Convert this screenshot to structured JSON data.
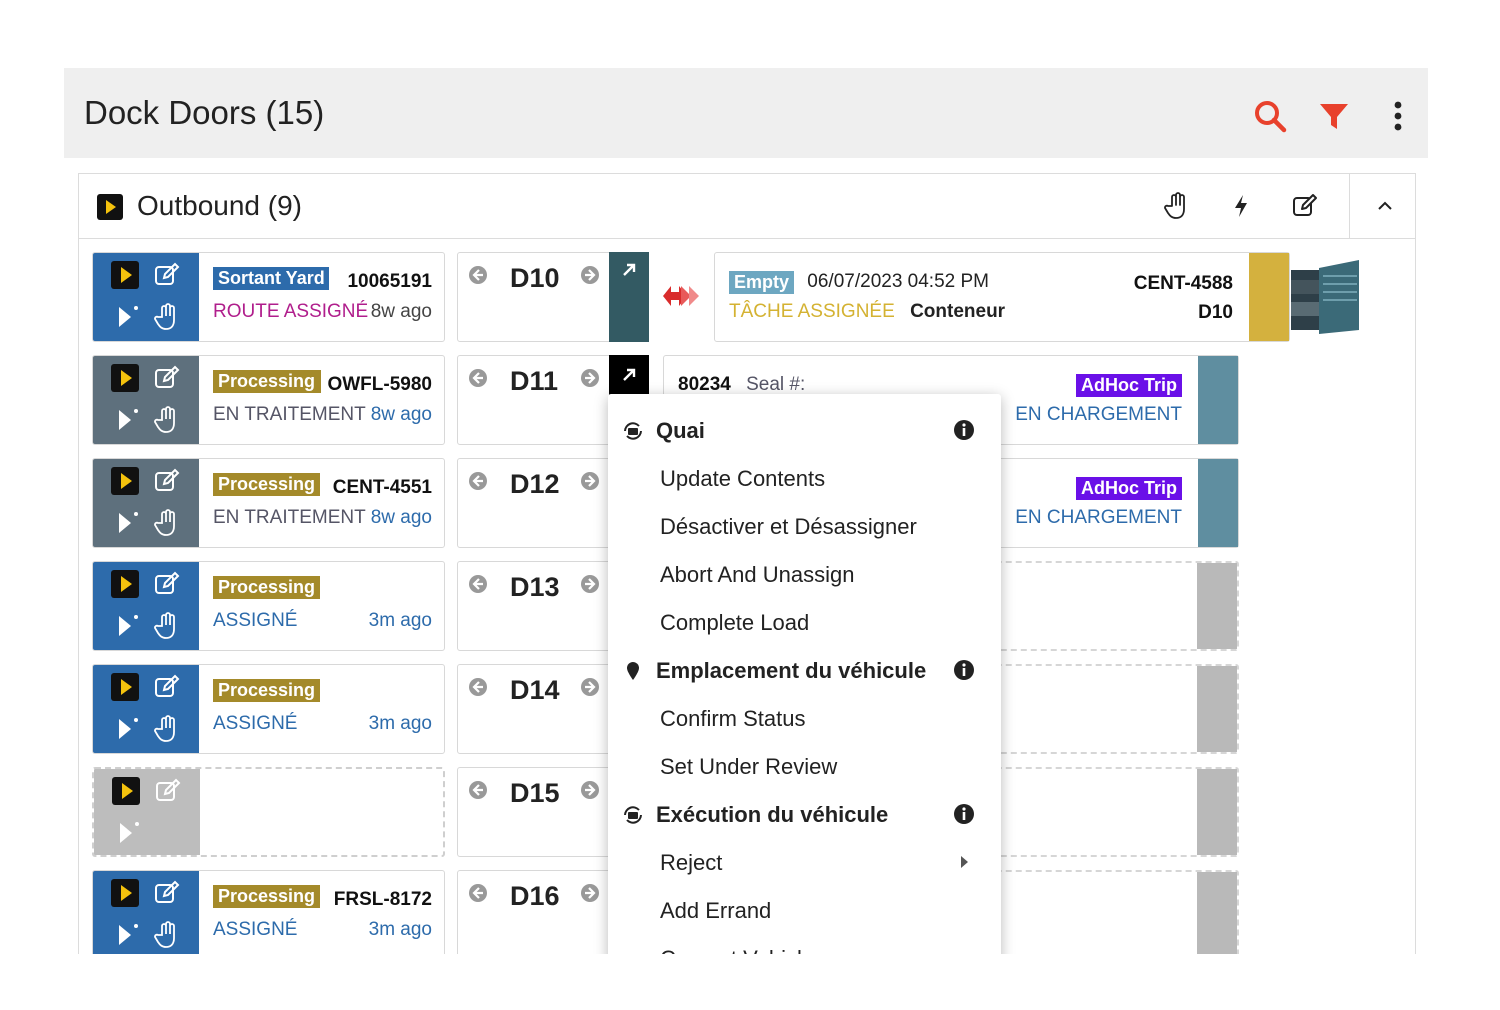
{
  "header": {
    "title": "Dock Doors (15)",
    "search_icon": "search-icon",
    "filter_icon": "filter-icon",
    "more_icon": "more-vertical-icon",
    "accent": "#e8412c"
  },
  "section": {
    "title": "Outbound (9)"
  },
  "rows": [
    {
      "card": {
        "tag": "Sortant Yard",
        "code": "10065191",
        "status": "ROUTE ASSIGNÉ",
        "ago": "8w ago"
      },
      "door": "D10",
      "slot": {
        "tag": "Empty",
        "datetime": "06/07/2023 04:52 PM",
        "id": "CENT-4588",
        "status": "TÂCHE ASSIGNÉE",
        "kind": "Conteneur",
        "door": "D10"
      }
    },
    {
      "card": {
        "tag": "Processing",
        "code": "OWFL-5980",
        "status": "EN TRAITEMENT",
        "ago": "8w ago"
      },
      "door": "D11",
      "slot": {
        "number": "80234",
        "seal": "Seal #:",
        "tag": "AdHoc Trip",
        "status": "EN CHARGEMENT"
      }
    },
    {
      "card": {
        "tag": "Processing",
        "code": "CENT-4551",
        "status": "EN TRAITEMENT",
        "ago": "8w ago"
      },
      "door": "D12",
      "slot": {
        "tag": "AdHoc Trip",
        "status": "EN CHARGEMENT"
      }
    },
    {
      "card": {
        "tag": "Processing",
        "status": "ASSIGNÉ",
        "ago": "3m ago"
      },
      "door": "D13"
    },
    {
      "card": {
        "tag": "Processing",
        "status": "ASSIGNÉ",
        "ago": "3m ago"
      },
      "door": "D14"
    },
    {
      "door": "D15"
    },
    {
      "card": {
        "tag": "Processing",
        "code": "FRSL-8172",
        "status": "ASSIGNÉ",
        "ago": "3m ago"
      },
      "door": "D16"
    }
  ],
  "menu": {
    "items": [
      {
        "label": "Quai",
        "header": true,
        "icon": "dock-icon"
      },
      {
        "label": "Update Contents"
      },
      {
        "label": "Désactiver et Désassigner"
      },
      {
        "label": "Abort And Unassign"
      },
      {
        "label": "Complete Load"
      },
      {
        "label": "Emplacement du véhicule",
        "header": true,
        "icon": "location-pin-icon"
      },
      {
        "label": "Confirm Status"
      },
      {
        "label": "Set Under Review"
      },
      {
        "label": "Exécution du véhicule",
        "header": true,
        "icon": "vehicle-execution-icon"
      },
      {
        "label": "Reject",
        "submenu": true
      },
      {
        "label": "Add Errand"
      },
      {
        "label": "Convert Vehicle"
      }
    ]
  }
}
